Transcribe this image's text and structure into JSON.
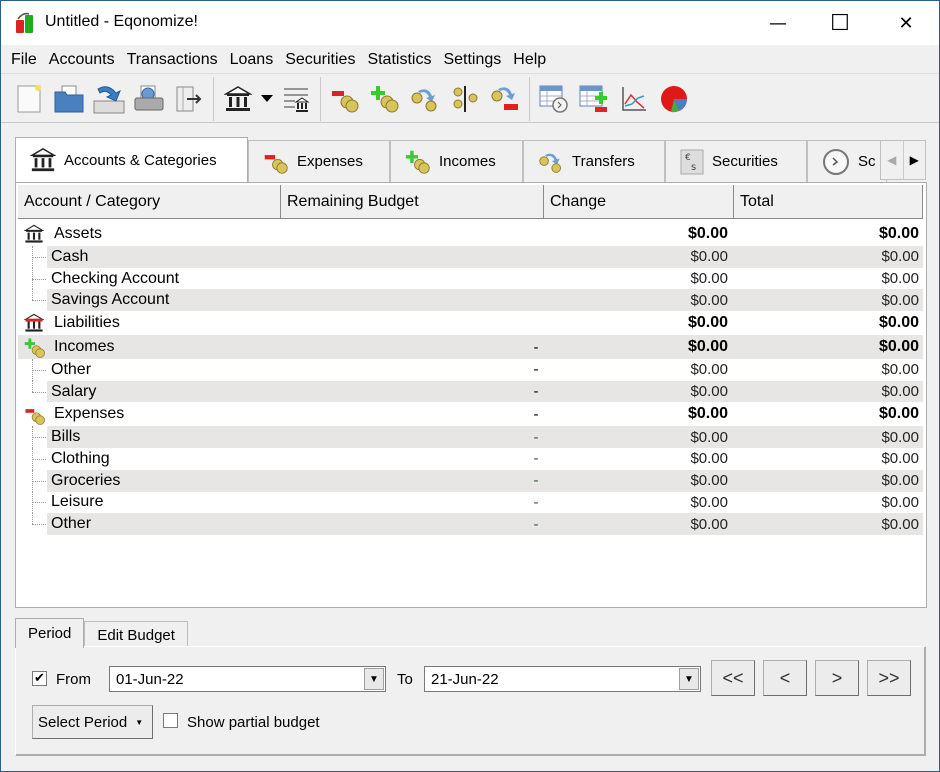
{
  "window": {
    "title": "Untitled - Eqonomize!",
    "controls": {
      "minimize": "—",
      "maximize": "☐",
      "close": "✕"
    }
  },
  "menu": [
    "File",
    "Accounts",
    "Transactions",
    "Loans",
    "Securities",
    "Statistics",
    "Settings",
    "Help"
  ],
  "toolbar": [
    {
      "name": "new-file",
      "icon": "new-document-icon"
    },
    {
      "name": "open-file",
      "icon": "open-folder-icon"
    },
    {
      "name": "save-file",
      "icon": "save-icon"
    },
    {
      "name": "print",
      "icon": "print-icon"
    },
    {
      "name": "export",
      "icon": "export-icon"
    },
    {
      "name": "new-account",
      "icon": "bank-icon"
    },
    {
      "name": "new-account-menu",
      "icon": "dropdown-arrow-icon"
    },
    {
      "name": "account-list",
      "icon": "account-list-icon"
    },
    {
      "name": "new-expense",
      "icon": "expense-icon"
    },
    {
      "name": "new-income",
      "icon": "income-icon"
    },
    {
      "name": "new-transfer",
      "icon": "transfer-icon"
    },
    {
      "name": "split-transaction",
      "icon": "split-icon"
    },
    {
      "name": "new-debt-payment",
      "icon": "payment-icon"
    },
    {
      "name": "scheduled-transactions",
      "icon": "schedule-table-icon"
    },
    {
      "name": "edit-budget",
      "icon": "budget-table-icon"
    },
    {
      "name": "line-chart",
      "icon": "line-chart-icon"
    },
    {
      "name": "pie-chart",
      "icon": "pie-chart-icon"
    }
  ],
  "tabs": [
    {
      "label": "Accounts & Categories",
      "icon": "bank-icon",
      "active": true
    },
    {
      "label": "Expenses",
      "icon": "expense-icon",
      "active": false
    },
    {
      "label": "Incomes",
      "icon": "income-icon",
      "active": false
    },
    {
      "label": "Transfers",
      "icon": "transfer-icon",
      "active": false
    },
    {
      "label": "Securities",
      "icon": "securities-icon",
      "active": false
    },
    {
      "label": "Sc",
      "icon": "clock-icon",
      "active": false
    }
  ],
  "tab_scroll": {
    "left": "◀",
    "right": "▶"
  },
  "table": {
    "columns": [
      "Account / Category",
      "Remaining Budget",
      "Change",
      "Total"
    ],
    "rows": [
      {
        "level": 0,
        "icon": "bank-icon",
        "name": "Assets",
        "budget": "",
        "change": "$0.00",
        "total": "$0.00"
      },
      {
        "level": 1,
        "name": "Cash",
        "budget": "",
        "change": "$0.00",
        "total": "$0.00"
      },
      {
        "level": 1,
        "name": "Checking Account",
        "budget": "",
        "change": "$0.00",
        "total": "$0.00"
      },
      {
        "level": 1,
        "name": "Savings Account",
        "budget": "",
        "change": "$0.00",
        "total": "$0.00",
        "last": true
      },
      {
        "level": 0,
        "icon": "liabilities-icon",
        "name": "Liabilities",
        "budget": "",
        "change": "$0.00",
        "total": "$0.00"
      },
      {
        "level": 0,
        "icon": "income-icon",
        "name": "Incomes",
        "budget": "-",
        "change": "$0.00",
        "total": "$0.00"
      },
      {
        "level": 1,
        "name": "Other",
        "budget": "-",
        "change": "$0.00",
        "total": "$0.00"
      },
      {
        "level": 1,
        "name": "Salary",
        "budget": "-",
        "change": "$0.00",
        "total": "$0.00",
        "last": true
      },
      {
        "level": 0,
        "icon": "expense-icon",
        "name": "Expenses",
        "budget": "-",
        "change": "$0.00",
        "total": "$0.00"
      },
      {
        "level": 1,
        "name": "Bills",
        "budget": "-",
        "change": "$0.00",
        "total": "$0.00",
        "budget_color": "#2e5e2e"
      },
      {
        "level": 1,
        "name": "Clothing",
        "budget": "-",
        "change": "$0.00",
        "total": "$0.00",
        "budget_color": "#2e5e2e"
      },
      {
        "level": 1,
        "name": "Groceries",
        "budget": "-",
        "change": "$0.00",
        "total": "$0.00",
        "budget_color": "#2e5e2e"
      },
      {
        "level": 1,
        "name": "Leisure",
        "budget": "-",
        "change": "$0.00",
        "total": "$0.00",
        "budget_color": "#2e5e2e"
      },
      {
        "level": 1,
        "name": "Other",
        "budget": "-",
        "change": "$0.00",
        "total": "$0.00",
        "budget_color": "#2e5e2e",
        "last": true
      }
    ]
  },
  "bottom_tabs": [
    {
      "label": "Period",
      "active": true
    },
    {
      "label": "Edit Budget",
      "active": false
    }
  ],
  "period": {
    "from_checked": true,
    "from_label": "From",
    "from_value": "01-Jun-22",
    "to_label": "To",
    "to_value": "21-Jun-22",
    "nav": [
      "<<",
      "<",
      ">",
      ">>"
    ],
    "select_period_label": "Select Period",
    "show_partial_label": "Show partial budget",
    "show_partial_checked": false
  }
}
